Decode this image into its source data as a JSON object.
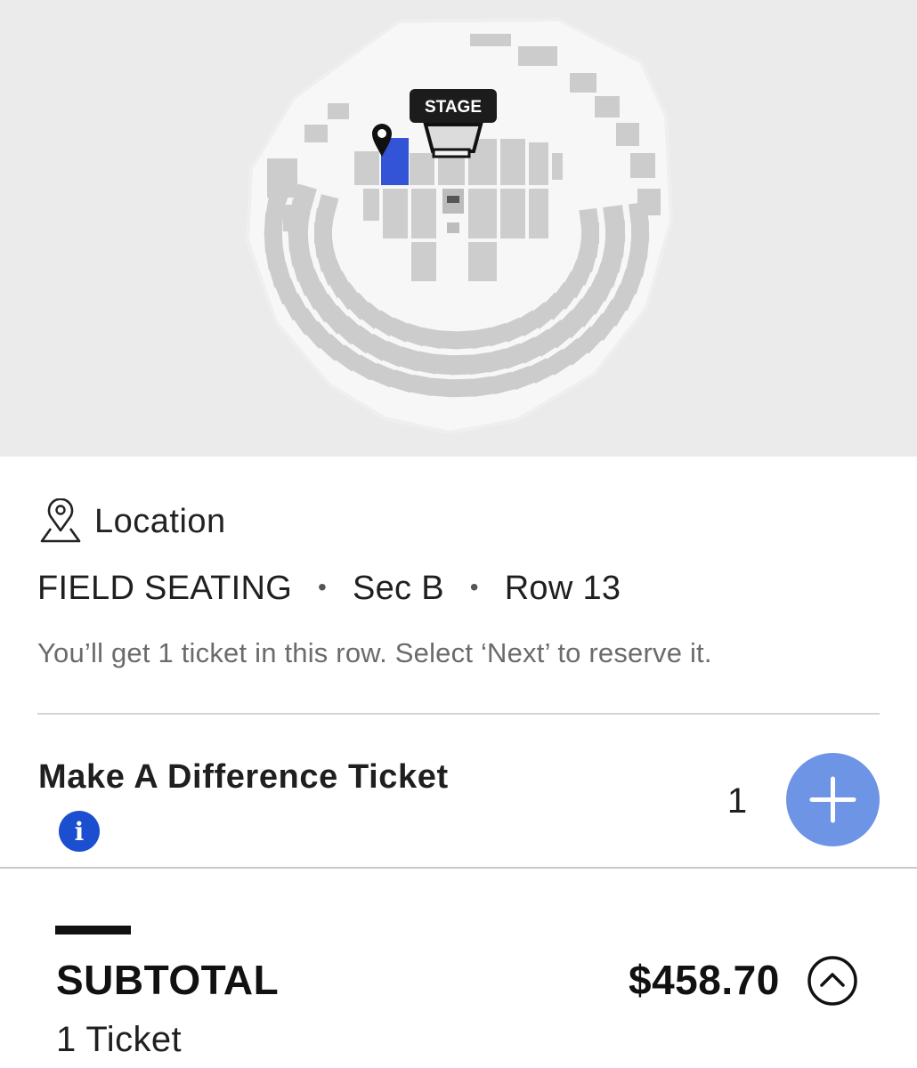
{
  "seat_map": {
    "stage_label": "STAGE",
    "selected_color": "#3354d6",
    "section_color": "#cccccc",
    "venue_background": "#f6f6f6",
    "page_background": "#ebebeb"
  },
  "location": {
    "icon": "location-pin-icon",
    "title": "Location",
    "area": "FIELD SEATING",
    "separator": "•",
    "section": "Sec B",
    "row": "Row 13",
    "note": "You’ll get 1 ticket in this row. Select ‘Next’ to reserve it."
  },
  "ticket_type": {
    "name": "Make A Difference Ticket",
    "info_icon": "info-icon",
    "info_glyph": "i",
    "quantity": "1",
    "add_icon": "plus-icon",
    "accent_color": "#6e94e6"
  },
  "summary": {
    "subtotal_label": "SUBTOTAL",
    "subtotal_amount": "$458.70",
    "ticket_count": "1 Ticket",
    "toggle_icon": "chevron-up-icon"
  }
}
